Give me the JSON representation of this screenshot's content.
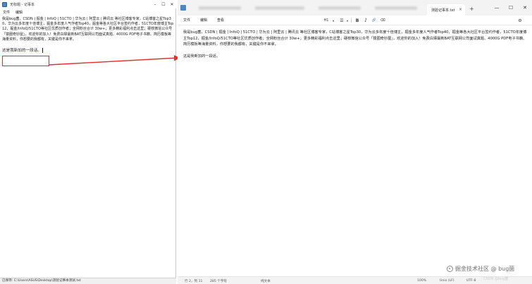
{
  "left_window": {
    "title": "无标题 - 记事本",
    "menu": [
      "文件",
      "编辑"
    ],
    "body_text": "我是bug菌，CSDN | 掘金 | InfoQ | 51CTO | 华为云 | 阿里云 | 腾讯云 等社区博客专家，C站博客之星Top30，华为云多年度十佳博主，掘金多年度人气作者Top40，掘金等各大社区平台签约作者，51CTO年度博主Top12，掘金/InfoQ/51CTO等社区优质创作者；全网粉丝合计 30w+；更多精彩福利点击这里；硬核微信公众号「猿圈奇妙屋」，欢迎你的加入！免费白嫖最新BAT互联网公司面试真题、4000G PDF电子书籍、简历模板等海量资料，你想要的我都有，关键是你不来拿。",
    "new_line": "这是我新加的一段话。",
    "status_text": "已保存: C:\\Users\\ASUS\\Desktop\\测验记事本测试.txt"
  },
  "right_window": {
    "tab_label": "测验记事本.txt",
    "new_tab": "+",
    "controls": [
      "—",
      "☐",
      "✕"
    ],
    "menu": [
      "文件",
      "编辑",
      "查看"
    ],
    "toolbar": {
      "heading": "H1",
      "list": "☰",
      "bold": "B",
      "italic": "I",
      "link": "🔗",
      "clear": "⌫"
    },
    "body_text": "我是bug菌，CSDN | 掘金 | InfoQ | 51CTO | 华为云 | 阿里云 | 腾讯云 等社区博客专家，C站博客之星Top30，华为云多年度十佳博主，掘金多年度人气作者Top40，掘金等各大社区平台签约作者，51CTO年度博主Top12，掘金/InfoQ/51CTO等社区优质创作者；全网粉丝合计 30w+；更多精彩福利点击这里；硬核微信公众号「猿圈奇妙屋」，欢迎你的加入！免费白嫖最新BAT互联网公司面试真题、4000G PDF电子书籍、简历模板等海量资料，你想要的我都有，关键是你不来拿。",
    "new_line": "这是我新加的一段话。",
    "status": {
      "position": "行 2，列 11",
      "chars": "285 个字符",
      "format": "纯文本",
      "zoom": "100%",
      "line_ending": "Unix (LF)",
      "encoding": "UTF-8"
    }
  },
  "watermark": {
    "text": "掘金技术社区 @ bug菌",
    "ghost": "CSDN @bug菌"
  },
  "colors": {
    "highlight": "#e0302a",
    "app_icon": "#4a86c8"
  }
}
